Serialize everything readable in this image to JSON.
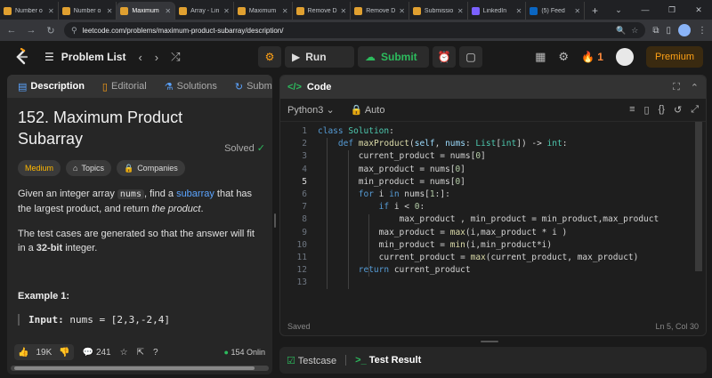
{
  "browser": {
    "tabs": [
      {
        "label": "Number o",
        "active": false,
        "fav_color": "#e0a030"
      },
      {
        "label": "Number o",
        "active": false,
        "fav_color": "#e0a030"
      },
      {
        "label": "Maximum",
        "active": true,
        "fav_color": "#e0a030"
      },
      {
        "label": "Array - Lin",
        "active": false,
        "fav_color": "#e0a030"
      },
      {
        "label": "Maximum",
        "active": false,
        "fav_color": "#e0a030"
      },
      {
        "label": "Remove D",
        "active": false,
        "fav_color": "#e0a030"
      },
      {
        "label": "Remove D",
        "active": false,
        "fav_color": "#e0a030"
      },
      {
        "label": "Submissio",
        "active": false,
        "fav_color": "#e0a030"
      },
      {
        "label": "LinkedIn",
        "active": false,
        "fav_color": "#7b61ff"
      },
      {
        "label": "(5) Feed",
        "active": false,
        "fav_color": "#0a66c2"
      }
    ],
    "url": "leetcode.com/problems/maximum-product-subarray/description/"
  },
  "header": {
    "problem_list_label": "Problem List",
    "run_label": "Run",
    "submit_label": "Submit",
    "streak": "1",
    "premium_label": "Premium"
  },
  "left": {
    "tabs": [
      "Description",
      "Editorial",
      "Solutions",
      "Submi"
    ],
    "title": "152. Maximum Product Subarray",
    "status": "Solved",
    "tags": [
      "Medium",
      "Topics",
      "Companies"
    ],
    "desc_part1": "Given an integer array ",
    "desc_code": "nums",
    "desc_part2": ", find a ",
    "desc_link": "subarray",
    "desc_part3": " that has the largest product, and return ",
    "desc_em": "the product",
    "desc_part4": ".",
    "desc2_part1": "The test cases are generated so that the answer will fit in a ",
    "desc2_bold": "32-bit",
    "desc2_part2": " integer.",
    "example_title": "Example 1:",
    "example_input_label": "Input:",
    "example_input_value": "nums = [2,3,-2,4]",
    "likes": "19K",
    "comments": "241",
    "online": "154 Onlin"
  },
  "right": {
    "title": "Code",
    "language": "Python3",
    "autosave": "Auto",
    "saved": "Saved",
    "cursor": "Ln 5, Col 30",
    "lines": [
      "1",
      "2",
      "3",
      "4",
      "5",
      "6",
      "7",
      "8",
      "9",
      "10",
      "11",
      "12",
      "13"
    ],
    "current_line": 5
  },
  "bottom": {
    "testcase_label": "Testcase",
    "result_label": "Test Result"
  }
}
